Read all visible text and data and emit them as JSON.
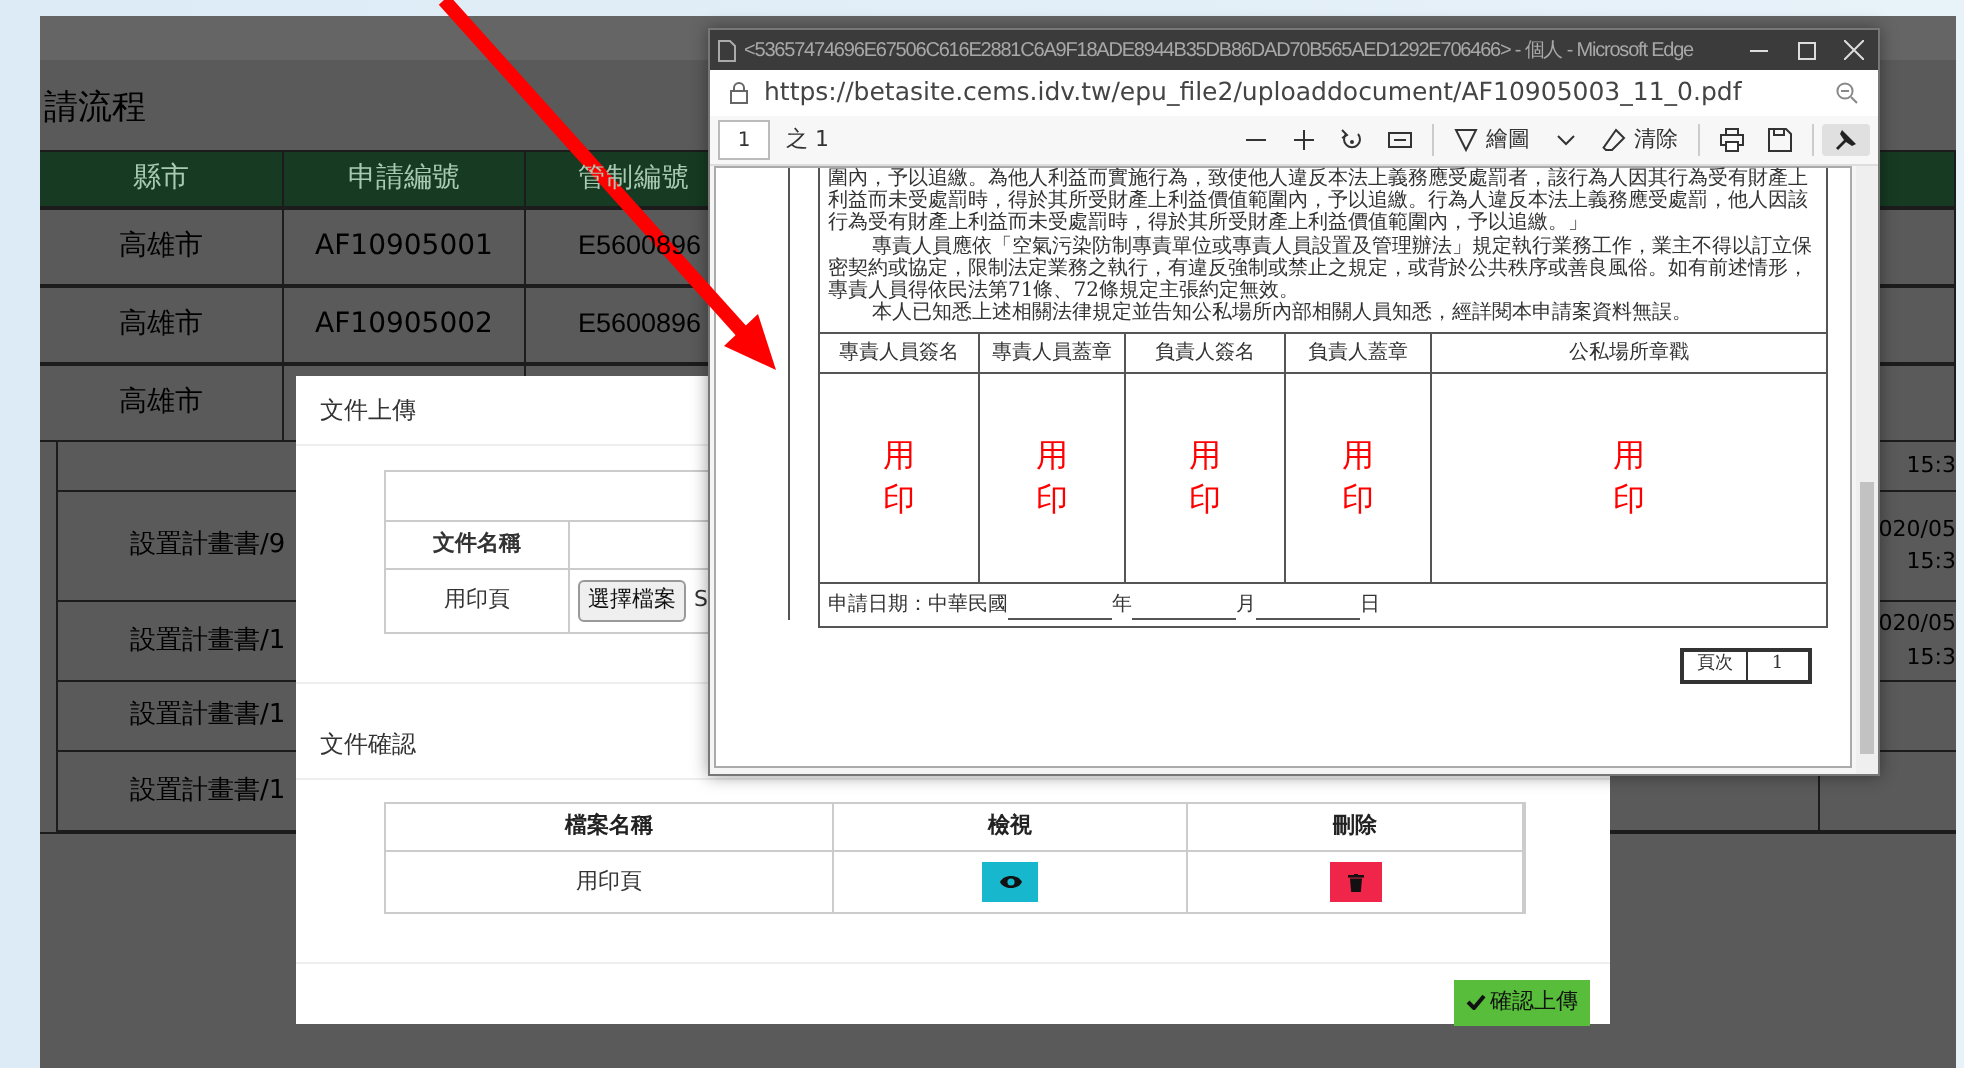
{
  "page": {
    "title": "請流程",
    "columns": [
      "縣市",
      "申請編號",
      "管制編號"
    ],
    "rows": [
      [
        "高雄市",
        "AF10905001",
        "E5600896"
      ],
      [
        "高雄市",
        "AF10905002",
        "E5600896"
      ],
      [
        "高雄市"
      ]
    ],
    "documents": [
      {
        "time": [
          "15:3"
        ]
      },
      {
        "name": "設置計畫書/9",
        "time": [
          "020/05",
          "15:3"
        ]
      },
      {
        "name": "設置計畫書/1",
        "time": [
          "020/05",
          "15:3"
        ]
      },
      {
        "name": "設置計畫書/1"
      },
      {
        "name": "設置計畫書/1"
      }
    ]
  },
  "modal": {
    "upload": {
      "title": "文件上傳",
      "name_header": "文件名稱",
      "rows": [
        {
          "name": "用印頁",
          "button": "選擇檔案",
          "status": "S"
        }
      ]
    },
    "confirm": {
      "title": "文件確認",
      "columns": [
        "檔案名稱",
        "檢視",
        "刪除"
      ],
      "rows": [
        {
          "name": "用印頁"
        }
      ]
    },
    "submit": "確認上傳"
  },
  "browser_window": {
    "title": "<53657474696E67506C616E2881C6A9F18ADE8944B35DB86DAD70B565AED1292E706466> - 個人 - Microsoft Edge",
    "url": "https://betasite.cems.idv.tw/epu_file2/uploaddocument/AF10905003_11_0.pdf",
    "page_number": "1",
    "page_count": "之 1",
    "tool_groups": [
      [
        {
          "kind": "zoom-out",
          "on": false
        },
        {
          "kind": "zoom-in",
          "on": false
        },
        {
          "kind": "rotate",
          "on": false
        },
        {
          "kind": "fit",
          "on": false
        }
      ],
      [
        {
          "kind": "draw",
          "label": "繪圖",
          "on": false
        },
        {
          "kind": "dropdown",
          "on": false
        },
        {
          "kind": "erase",
          "label": "清除",
          "on": false
        }
      ],
      [
        {
          "kind": "print",
          "on": false
        },
        {
          "kind": "save",
          "on": false
        }
      ],
      [
        {
          "kind": "pin",
          "on": true
        }
      ]
    ],
    "document": {
      "paragraphs": [
        {
          "text": "圍內，予以追繳。為他人利益而實施行為，致使他人違反本法上義務應受處罰者，該行為人因其行為受有財產上利益而未受處罰時，得於其所受財產上利益價值範圍內，予以追繳。行為人違反本法上義務應受處罰，他人因該行為受有財產上利益而未受處罰時，得於其所受財產上利益價值範圍內，予以追繳。」",
          "indented": false
        },
        {
          "text": "專責人員應依「空氣污染防制專責單位或專責人員設置及管理辦法」規定執行業務工作，業主不得以訂立保密契約或協定，限制法定業務之執行，有違反強制或禁止之規定，或背於公共秩序或善良風俗。如有前述情形，專責人員得依民法第71條、72條規定主張約定無效。",
          "indented": true
        },
        {
          "text": "本人已知悉上述相關法律規定並告知公私場所內部相關人員知悉，經詳閱本申請案資料無誤。",
          "indented": true
        }
      ],
      "signature_columns": [
        "專責人員簽名",
        "專責人員蓋章",
        "負責人簽名",
        "負責人蓋章",
        "公私場所章戳"
      ],
      "stamps": [
        "用印",
        "用印",
        "用印",
        "用印",
        "用印"
      ],
      "date_label": "申請日期：中華民國",
      "date_units": [
        "年",
        "月",
        "日"
      ],
      "page_box": {
        "label": "頁次",
        "value": "1"
      }
    }
  }
}
